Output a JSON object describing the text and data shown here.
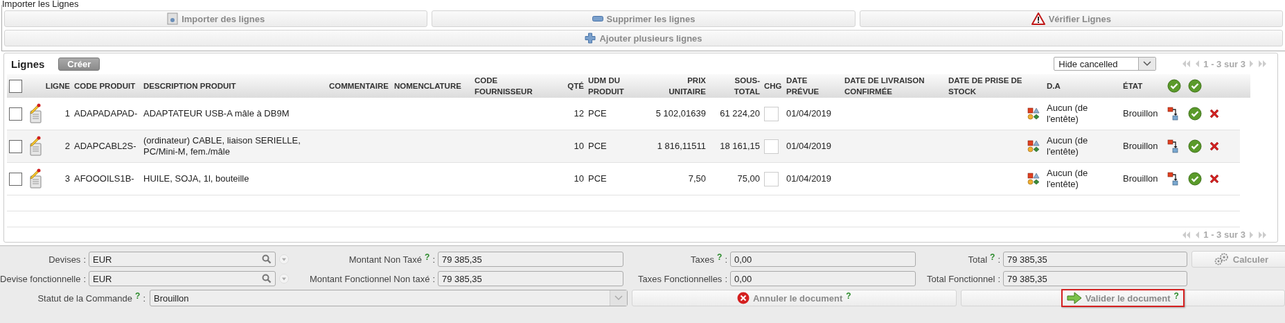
{
  "import_panel": {
    "legend": "Importer les Lignes",
    "buttons": [
      {
        "label": "Importer des lignes",
        "kind": "import"
      },
      {
        "label": "Supprimer les lignes",
        "kind": "remove"
      },
      {
        "label": "Vérifier Lignes",
        "kind": "warning"
      }
    ],
    "add_button": {
      "label": "Ajouter plusieurs lignes",
      "kind": "add"
    }
  },
  "lines": {
    "title": "Lignes",
    "create_button": "Créer",
    "filter": {
      "value": "Hide cancelled"
    },
    "pager": "1 - 3 sur 3",
    "bottom_pager": "1 - 3 sur 3",
    "select_all_checked": false,
    "columns": [
      "LIGNE",
      "CODE PRODUIT",
      "DESCRIPTION PRODUIT",
      "COMMENTAIRE",
      "NOMENCLATURE",
      "CODE FOURNISSEUR",
      "QTÉ",
      "UDM DU PRODUIT",
      "PRIX UNITAIRE",
      "SOUS-TOTAL",
      "CHG",
      "DATE PRÉVUE",
      "DATE DE LIVRAISON CONFIRMÉE",
      "DATE DE PRISE DE STOCK",
      "D.A",
      "ÉTAT"
    ],
    "rows": [
      {
        "checked": false,
        "line": "1",
        "code": "ADAPADAPAD-",
        "description": "ADAPTATEUR USB-A mâle à DB9M",
        "qty": "12",
        "uom": "PCE",
        "unit_price": "5 102,01639",
        "subtotal": "61 224,20",
        "chg": false,
        "date": "01/04/2019",
        "da": "Aucun (de l'entête)",
        "status": "Brouillon"
      },
      {
        "checked": false,
        "line": "2",
        "code": "ADAPCABL2S-",
        "description": "(ordinateur) CABLE, liaison SERIELLE, PC/Mini-M, fem./mâle",
        "qty": "10",
        "uom": "PCE",
        "unit_price": "1 816,11511",
        "subtotal": "18 161,15",
        "chg": false,
        "date": "01/04/2019",
        "da": "Aucun (de l'entête)",
        "status": "Brouillon"
      },
      {
        "checked": false,
        "line": "3",
        "code": "AFOOOILS1B-",
        "description": "HUILE, SOJA, 1l, bouteille",
        "qty": "10",
        "uom": "PCE",
        "unit_price": "7,50",
        "subtotal": "75,00",
        "chg": false,
        "date": "01/04/2019",
        "da": "Aucun (de l'entête)",
        "status": "Brouillon"
      }
    ]
  },
  "form": {
    "rows": [
      [
        {
          "label": "Devises",
          "colon": ":",
          "value": "EUR",
          "kind": "lookup"
        },
        {
          "label": "Montant Non Taxé",
          "help": "?",
          "colon": ":",
          "value": "79 385,35",
          "kind": "amount"
        },
        {
          "label": "Taxes",
          "help": "?",
          "colon": ":",
          "value": "0,00",
          "kind": "amount"
        },
        {
          "label": "Total",
          "help": "?",
          "colon": ":",
          "value": "79 385,35",
          "kind": "amount"
        }
      ],
      [
        {
          "label": "Devise fonctionnelle",
          "colon": ":",
          "value": "EUR",
          "kind": "lookup"
        },
        {
          "label": "Montant Fonctionnel Non taxé",
          "colon": ":",
          "value": "79 385,35",
          "kind": "amount"
        },
        {
          "label": "Taxes Fonctionnelles",
          "colon": ":",
          "value": "0,00",
          "kind": "amount"
        },
        {
          "label": "Total Fonctionnel",
          "colon": ":",
          "value": "79 385,35",
          "kind": "amount"
        }
      ]
    ],
    "calculate_button": "Calculer",
    "status": {
      "label": "Statut de la Commande",
      "help": "?",
      "colon": ":",
      "value": "Brouillon"
    },
    "cancel_button": {
      "label": "Annuler le document",
      "help": "?"
    },
    "validate_button": {
      "label": "Valider le document",
      "help": "?",
      "highlighted": true
    }
  }
}
